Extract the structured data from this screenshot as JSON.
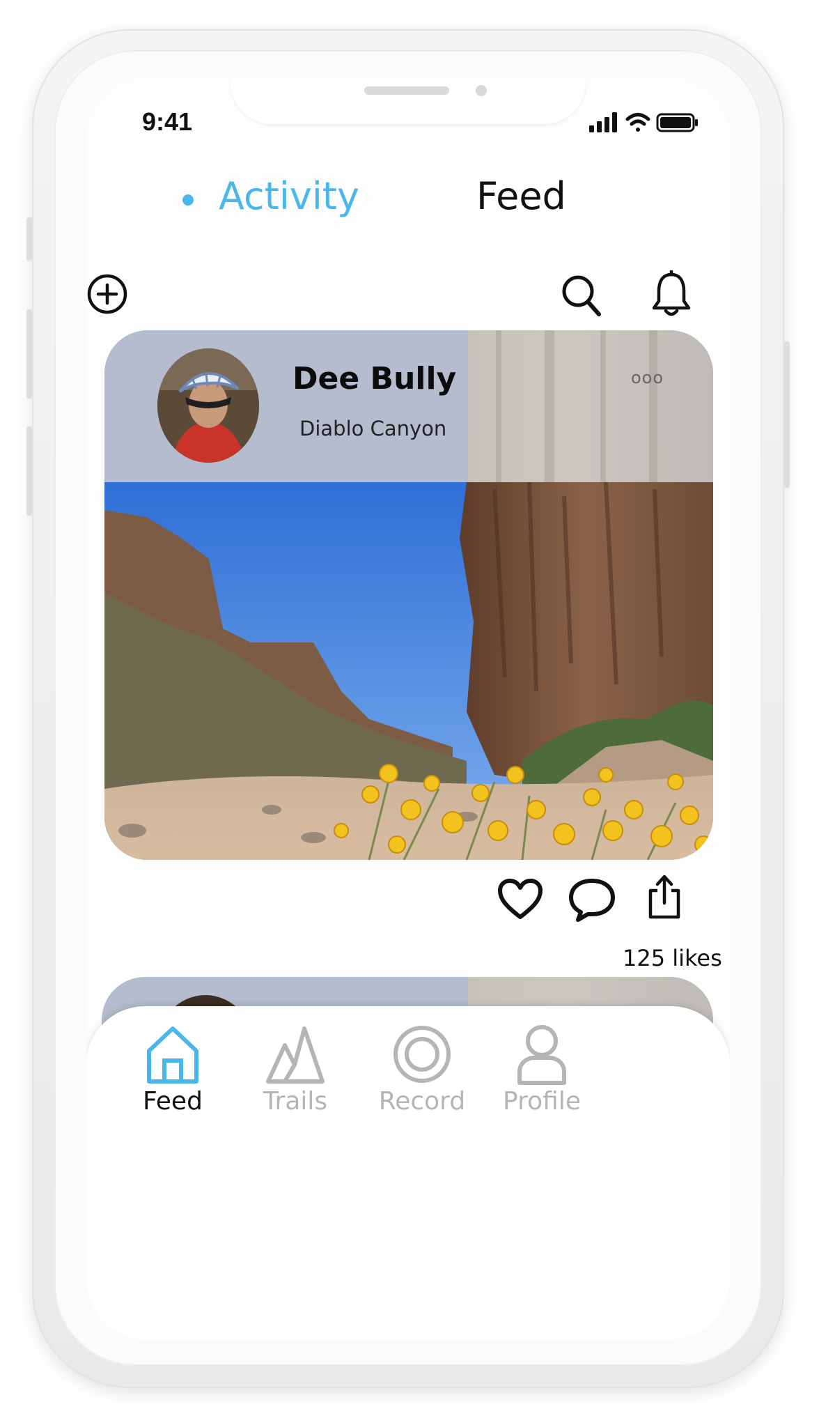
{
  "status_bar": {
    "time": "9:41"
  },
  "top_tabs": {
    "activity_label": "Activity",
    "feed_label": "Feed",
    "active": "Activity"
  },
  "toolbar": {
    "add_icon": "plus-circle-icon",
    "search_icon": "search-icon",
    "notifications_icon": "bell-icon"
  },
  "post": {
    "author_name": "Dee Bully",
    "location": "Diablo Canyon",
    "more_label": "ooo",
    "likes_text": "125 likes",
    "actions": [
      "heart-icon",
      "comment-icon",
      "share-icon"
    ]
  },
  "bottom_nav": {
    "items": [
      {
        "label": "Feed",
        "icon": "home-icon",
        "active": true
      },
      {
        "label": "Trails",
        "icon": "mountains-icon",
        "active": false
      },
      {
        "label": "Record",
        "icon": "record-icon",
        "active": false
      },
      {
        "label": "Profile",
        "icon": "person-icon",
        "active": false
      }
    ]
  },
  "colors": {
    "accent": "#49b7ea",
    "inactive": "#b5b5b5",
    "card_header": "#b4bccd"
  }
}
